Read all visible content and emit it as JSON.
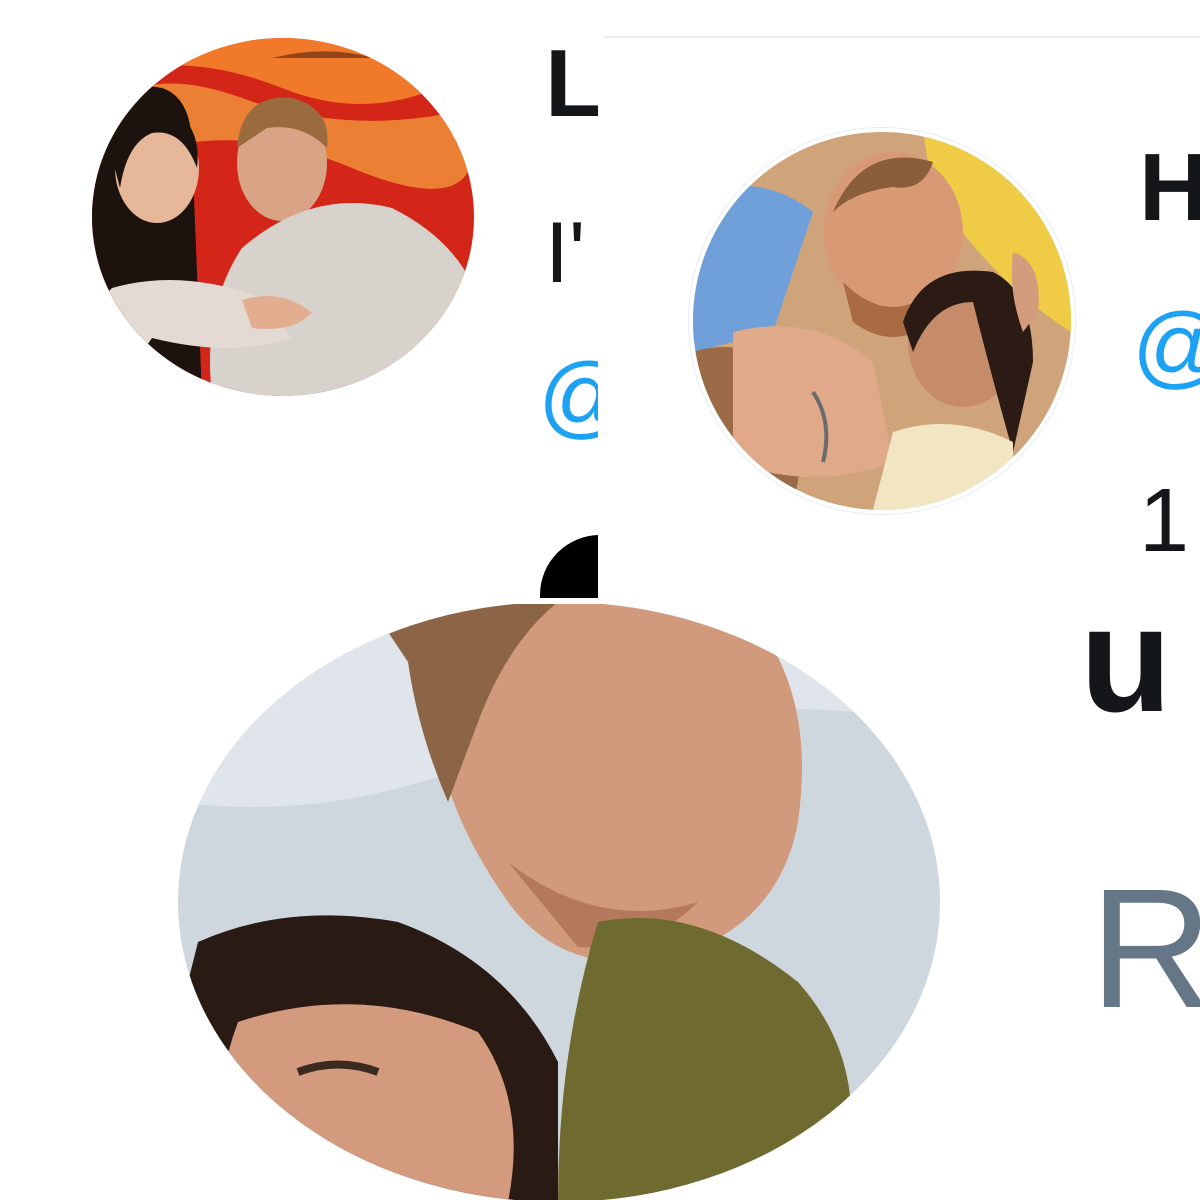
{
  "panels": [
    {
      "id": "panel-a",
      "avatar": {
        "icon": "profile-photo-couple-sunset",
        "background": "#d8281a"
      },
      "name_fragment": "L",
      "bio_fragment": "I'",
      "handle_fragment": "@",
      "handle_color": "#1da1f2"
    },
    {
      "id": "panel-b",
      "avatar": {
        "icon": "profile-photo-couple-selfie",
        "background": "#c89a70"
      },
      "name_fragment": "H",
      "handle_fragment": "@",
      "count_fragment": "1",
      "handle_color": "#1da1f2"
    },
    {
      "id": "panel-c",
      "avatar": {
        "icon": "profile-photo-couple-closeup",
        "background": "#c9d3dc"
      },
      "name_fragment": "u",
      "sub_fragment": "R",
      "muted_color": "#657786"
    }
  ],
  "colors": {
    "text": "#14171a",
    "accent": "#1da1f2",
    "muted": "#657786"
  }
}
